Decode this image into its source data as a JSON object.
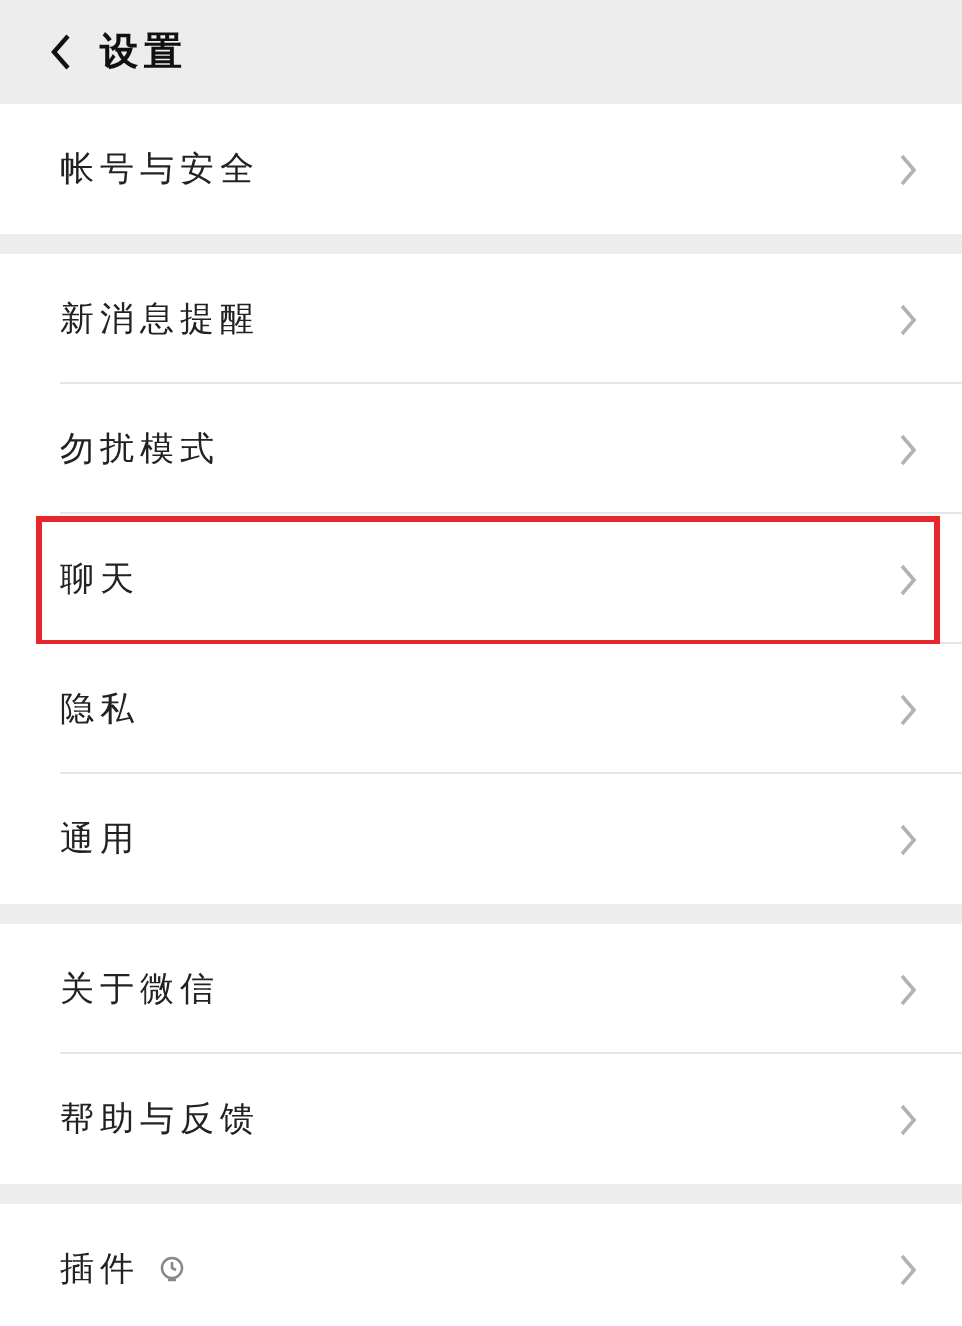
{
  "header": {
    "title": "设置"
  },
  "groups": [
    {
      "items": [
        {
          "label": "帐号与安全",
          "kind": "plain",
          "highlighted": false
        }
      ]
    },
    {
      "items": [
        {
          "label": "新消息提醒",
          "kind": "plain",
          "highlighted": false
        },
        {
          "label": "勿扰模式",
          "kind": "plain",
          "highlighted": false
        },
        {
          "label": "聊天",
          "kind": "plain",
          "highlighted": true
        },
        {
          "label": "隐私",
          "kind": "plain",
          "highlighted": false
        },
        {
          "label": "通用",
          "kind": "plain",
          "highlighted": false
        }
      ]
    },
    {
      "items": [
        {
          "label": "关于微信",
          "kind": "plain",
          "highlighted": false
        },
        {
          "label": "帮助与反馈",
          "kind": "plain",
          "highlighted": false
        }
      ]
    },
    {
      "items": [
        {
          "label": "插件",
          "kind": "with-icon",
          "highlighted": false
        }
      ]
    }
  ]
}
